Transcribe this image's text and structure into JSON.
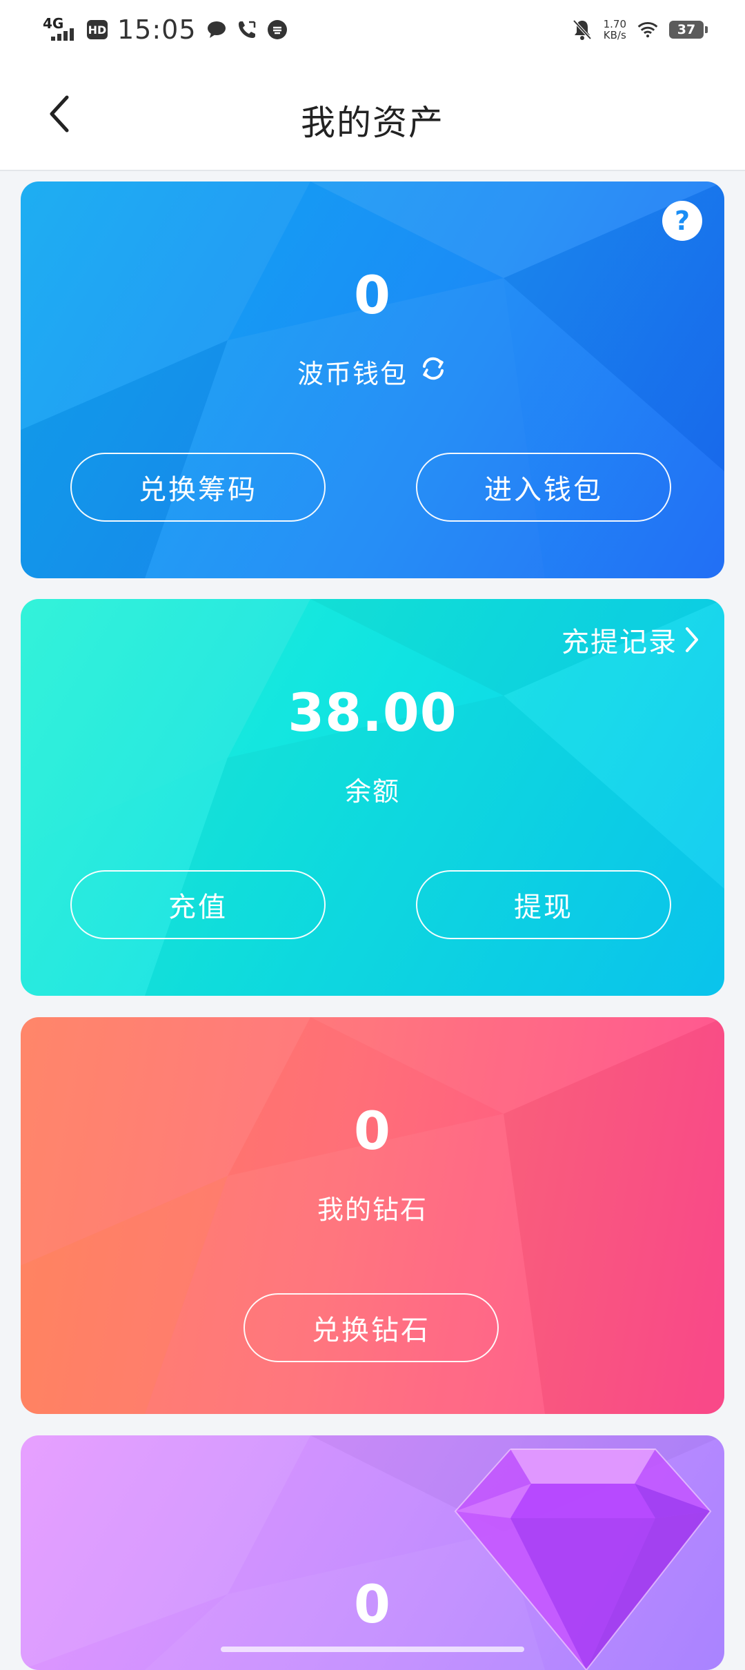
{
  "status_bar": {
    "network": "4G",
    "hd": "HD",
    "time": "15:05",
    "net_speed_value": "1.70",
    "net_speed_unit": "KB/s",
    "battery": "37"
  },
  "header": {
    "title": "我的资产"
  },
  "cards": {
    "wallet": {
      "value": "0",
      "label": "波币钱包",
      "help": "?",
      "btn_exchange_chips": "兑换筹码",
      "btn_enter_wallet": "进入钱包",
      "color": "#1a8ef5"
    },
    "balance": {
      "records_link": "充提记录",
      "value": "38.00",
      "label": "余额",
      "btn_recharge": "充值",
      "btn_withdraw": "提现",
      "color": "#10e3e2"
    },
    "diamond": {
      "value": "0",
      "label": "我的钻石",
      "btn_exchange_diamond": "兑换钻石",
      "color": "#ff6f78"
    },
    "gem": {
      "value": "0",
      "color": "#c890ff"
    }
  }
}
